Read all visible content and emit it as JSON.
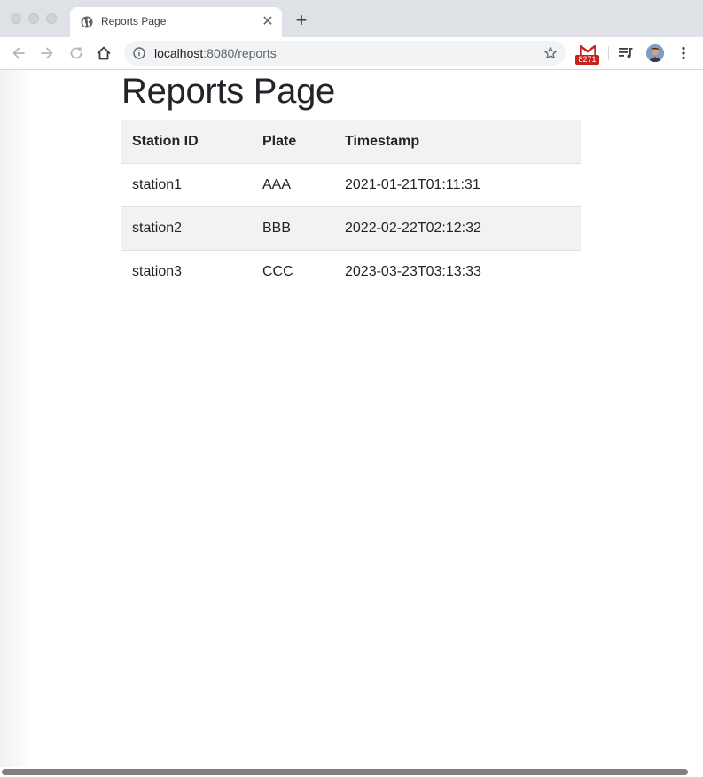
{
  "browser": {
    "tab": {
      "title": "Reports Page",
      "favicon": "globe-icon",
      "close_glyph": "✕"
    },
    "new_tab_glyph": "+",
    "address_bar": {
      "host": "localhost",
      "rest": ":8080/reports"
    },
    "extensions": {
      "gmail_badge": "8271"
    },
    "icons": [
      "back-arrow-icon",
      "forward-arrow-icon",
      "reload-icon",
      "home-icon",
      "info-icon",
      "bookmark-star-icon",
      "gmail-icon",
      "media-control-icon",
      "profile-avatar",
      "kebab-menu-icon"
    ]
  },
  "page": {
    "title": "Reports Page",
    "table": {
      "headers": [
        "Station ID",
        "Plate",
        "Timestamp"
      ],
      "rows": [
        [
          "station1",
          "AAA",
          "2021-01-21T01:11:31"
        ],
        [
          "station2",
          "BBB",
          "2022-02-22T02:12:32"
        ],
        [
          "station3",
          "CCC",
          "2023-03-23T03:13:33"
        ]
      ],
      "stripe_color": "#f2f2f2",
      "border_color": "#dee2e6"
    }
  }
}
